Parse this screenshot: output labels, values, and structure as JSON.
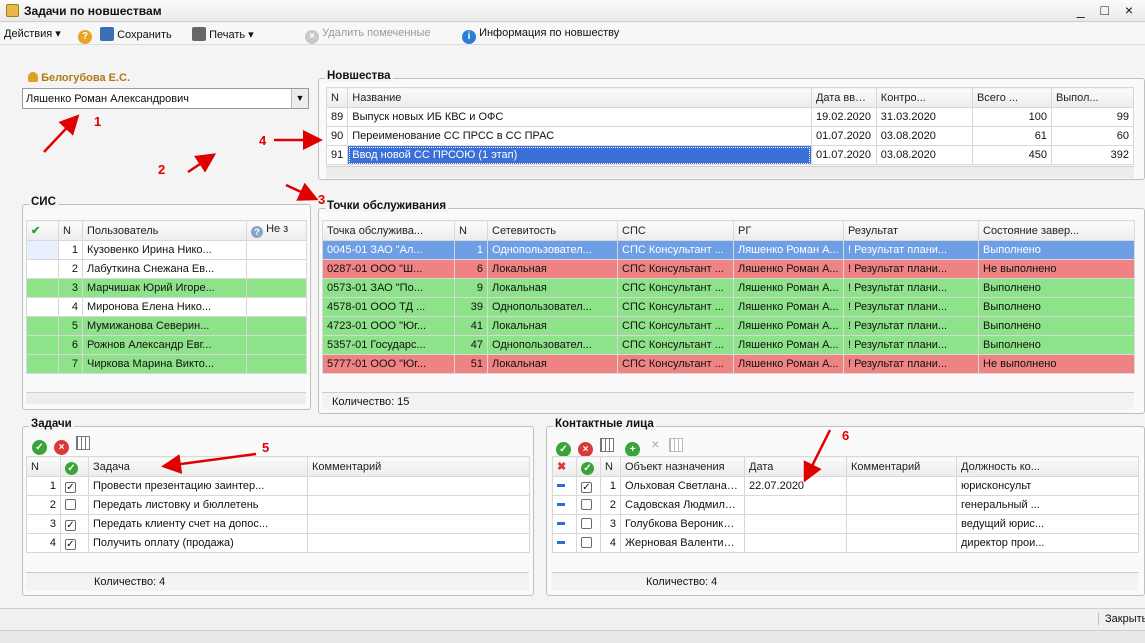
{
  "window": {
    "title": "Задачи по новшествам",
    "controls": "_ □ ×"
  },
  "toolbar": {
    "actions": "Действия ▾",
    "help": "?",
    "save": "Сохранить",
    "print": "Печать ▾",
    "delete_marked": "Удалить помеченные",
    "info": "Информация по новшеству"
  },
  "user_section": {
    "label": "Белогубова Е.С.",
    "selected": "Ляшенко Роман Александрович"
  },
  "novelties": {
    "title": "Новшества",
    "columns": [
      "N",
      "Название",
      "Дата ввод...",
      "Контро...",
      "Всего ...",
      "Выпол..."
    ],
    "rows": [
      [
        "89",
        "Выпуск новых ИБ КВС и ОФС",
        "19.02.2020",
        "31.03.2020",
        "100",
        "99"
      ],
      [
        "90",
        "Переименование СС ПРСС в СС ПРАС",
        "01.07.2020",
        "03.08.2020",
        "61",
        "60"
      ],
      [
        "91",
        "Ввод новой СС ПРСОЮ (1 этап)",
        "01.07.2020",
        "03.08.2020",
        "450",
        "392"
      ]
    ]
  },
  "sis": {
    "title": "СИС",
    "columns": [
      "N",
      "Пользователь",
      "Не з"
    ],
    "rows": [
      [
        "1",
        "Кузовенко Ирина Нико..."
      ],
      [
        "2",
        "Лабуткина Снежана Ев..."
      ],
      [
        "3",
        "Марчишак Юрий Игоре..."
      ],
      [
        "4",
        "Миронова Елена Нико..."
      ],
      [
        "5",
        "Мумижанова Северин..."
      ],
      [
        "6",
        "Рожнов Александр Евг..."
      ],
      [
        "7",
        "Чиркова Марина Викто..."
      ]
    ]
  },
  "points": {
    "title": "Точки обслуживания",
    "columns": [
      "Точка обслужива...",
      "N",
      "Сетевитость",
      "СПС",
      "РГ",
      "Результат",
      "Состояние завер..."
    ],
    "rows": [
      [
        "0045-01 ЗАО \"Ал...",
        "1",
        "Однопользовател...",
        "СПС Консультант ...",
        "Ляшенко Роман А...",
        "! Результат плани...",
        "Выполнено"
      ],
      [
        "0287-01 ООО \"Ш...",
        "6",
        "Локальная",
        "СПС Консультант ...",
        "Ляшенко Роман А...",
        "! Результат плани...",
        "Не выполнено"
      ],
      [
        "0573-01 ЗАО \"По...",
        "9",
        "Локальная",
        "СПС Консультант ...",
        "Ляшенко Роман А...",
        "! Результат плани...",
        "Выполнено"
      ],
      [
        "4578-01 ООО ТД ...",
        "39",
        "Однопользовател...",
        "СПС Консультант ...",
        "Ляшенко Роман А...",
        "! Результат плани...",
        "Выполнено"
      ],
      [
        "4723-01 ООО \"Юг...",
        "41",
        "Локальная",
        "СПС Консультант ...",
        "Ляшенко Роман А...",
        "! Результат плани...",
        "Выполнено"
      ],
      [
        "5357-01 Государс...",
        "47",
        "Однопользовател...",
        "СПС Консультант ...",
        "Ляшенко Роман А...",
        "! Результат плани...",
        "Выполнено"
      ],
      [
        "5777-01 ООО \"Юг...",
        "51",
        "Локальная",
        "СПС Консультант ...",
        "Ляшенко Роман А...",
        "! Результат плани...",
        "Не выполнено"
      ]
    ],
    "count": "Количество: 15"
  },
  "tasks": {
    "title": "Задачи",
    "columns": [
      "N",
      "Задача",
      "Комментарий"
    ],
    "rows": [
      [
        "1",
        "Провести презентацию заинтер..."
      ],
      [
        "2",
        "Передать листовку и бюллетень"
      ],
      [
        "3",
        "Передать клиенту счет на допос..."
      ],
      [
        "4",
        "Получить оплату (продажа)"
      ]
    ],
    "count": "Количество: 4"
  },
  "contacts": {
    "title": "Контактные лица",
    "columns": [
      "N",
      "Объект назначения",
      "Дата",
      "Комментарий",
      "Должность ко..."
    ],
    "rows": [
      [
        "1",
        "Ольховая Светлана Василь...",
        "22.07.2020",
        "",
        "юрисконсульт"
      ],
      [
        "2",
        "Садовская Людмила Петро...",
        "",
        "",
        "генеральный ..."
      ],
      [
        "3",
        "Голубкова Вероника Алекс...",
        "",
        "",
        "ведущий юрис..."
      ],
      [
        "4",
        "Жерновая Валентина Иван...",
        "",
        "",
        "директор прои..."
      ]
    ],
    "count": "Количество: 4"
  },
  "statusbar": {
    "close": "Закрыть"
  },
  "annotations": [
    "1",
    "2",
    "3",
    "4",
    "5",
    "6"
  ],
  "colors": {
    "green": "#8ee28a",
    "red": "#ef8383",
    "blue": "#6d9ee6",
    "annotation": "#e00000"
  }
}
